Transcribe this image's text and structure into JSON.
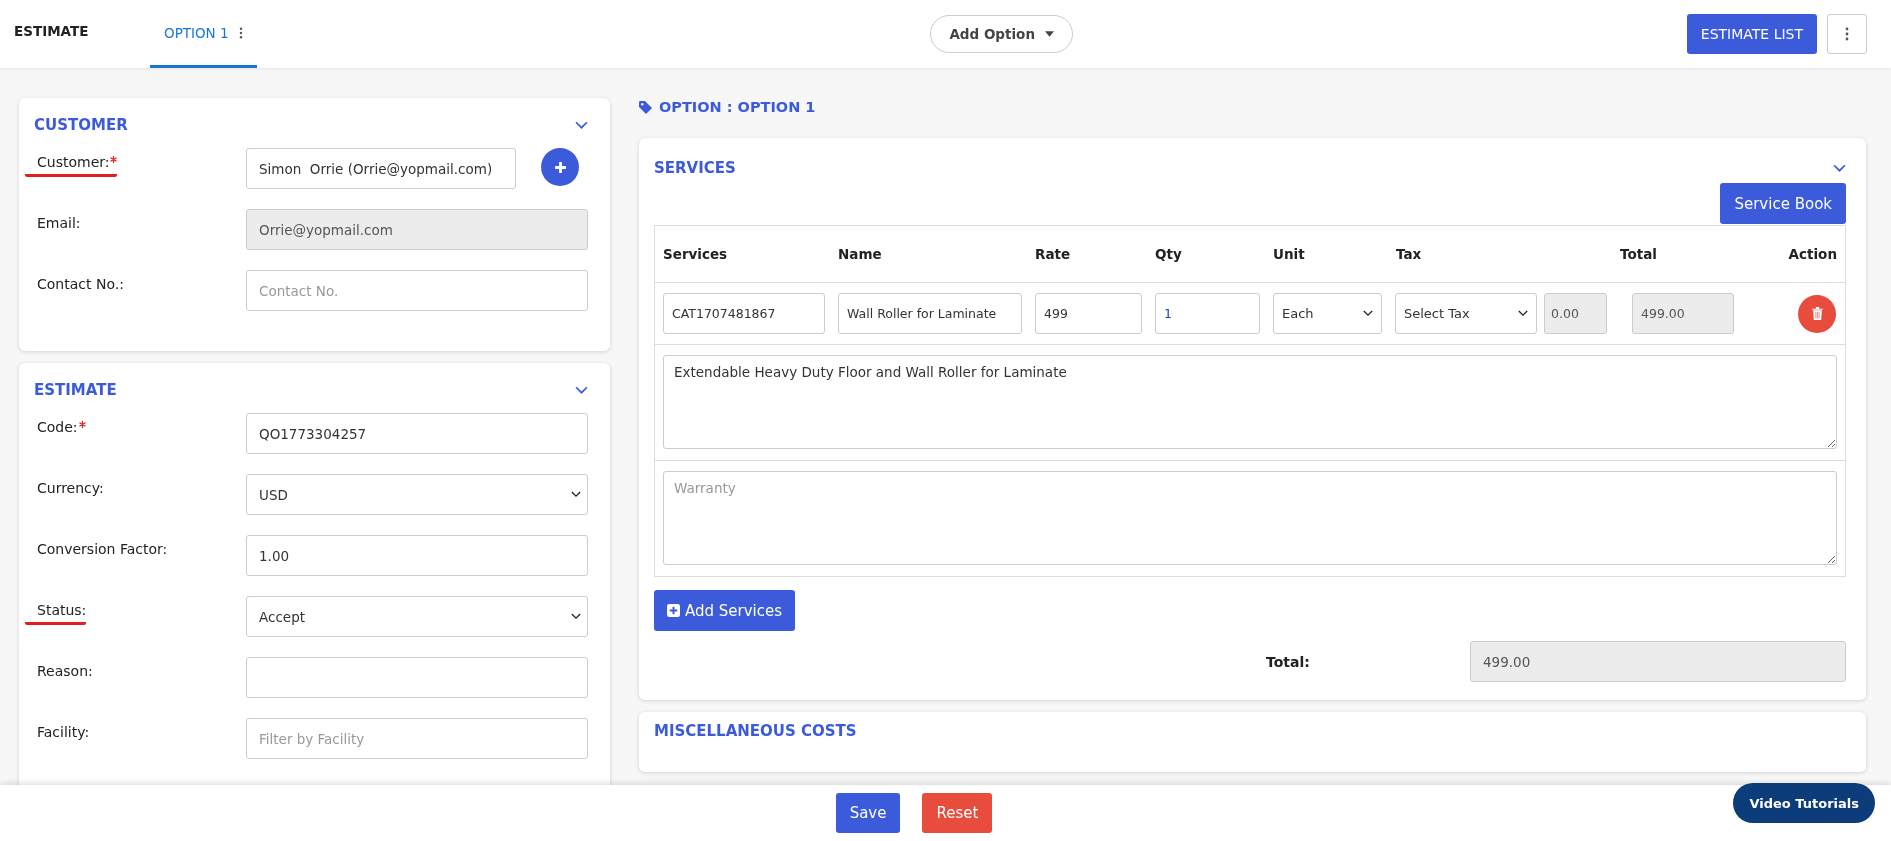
{
  "header": {
    "title": "ESTIMATE",
    "tabs": [
      {
        "label": "OPTION 1",
        "selected": true
      }
    ],
    "add_option": "Add Option",
    "estimate_list": "ESTIMATE LIST"
  },
  "customer_panel": {
    "title": "CUSTOMER",
    "fields": [
      {
        "label": "Customer:",
        "required": true,
        "underlined": true,
        "kind": "text",
        "value": "Simon  Orrie (Orrie@yopmail.com)",
        "add_button": true
      },
      {
        "label": "Email:",
        "required": false,
        "underlined": false,
        "kind": "text",
        "value": "Orrie@yopmail.com",
        "disabled": true
      },
      {
        "label": "Contact No.:",
        "required": false,
        "underlined": false,
        "kind": "text",
        "placeholder": "Contact No."
      }
    ]
  },
  "estimate_panel": {
    "title": "ESTIMATE",
    "fields": [
      {
        "label": "Code:",
        "required": true,
        "underlined": false,
        "kind": "text",
        "value": "QO1773304257"
      },
      {
        "label": "Currency:",
        "required": false,
        "underlined": false,
        "kind": "select",
        "value": "USD"
      },
      {
        "label": "Conversion Factor:",
        "required": false,
        "underlined": false,
        "kind": "text",
        "value": "1.00"
      },
      {
        "label": "Status:",
        "required": false,
        "underlined": true,
        "kind": "select",
        "value": "Accept"
      },
      {
        "label": "Reason:",
        "required": false,
        "underlined": false,
        "kind": "text"
      },
      {
        "label": "Facility:",
        "required": false,
        "underlined": false,
        "kind": "text",
        "placeholder": "Filter by Facility"
      }
    ]
  },
  "option_title": "OPTION : OPTION 1",
  "services_panel": {
    "title": "SERVICES",
    "service_book": "Service Book",
    "columns": [
      "Services",
      "Name",
      "Rate",
      "Qty",
      "Unit",
      "Tax",
      "Total",
      "Action"
    ],
    "rows": [
      {
        "service": "CAT1707481867",
        "name": "Wall Roller for Laminate",
        "rate": "499",
        "qty": "1",
        "unit": "Each",
        "tax": "Select Tax",
        "tax_amount": "0.00",
        "total": "499.00",
        "description": "Extendable Heavy Duty Floor and Wall Roller for Laminate",
        "warranty_placeholder": "Warranty"
      }
    ],
    "add_services": "Add Services",
    "total_label": "Total:",
    "total_value": "499.00"
  },
  "misc_panel": {
    "title": "MISCELLANEOUS COSTS"
  },
  "footer": {
    "buttons": [
      {
        "label": "Save",
        "kind": "primary"
      },
      {
        "label": "Reset",
        "kind": "danger"
      }
    ],
    "video_tutorials": "Video Tutorials"
  }
}
